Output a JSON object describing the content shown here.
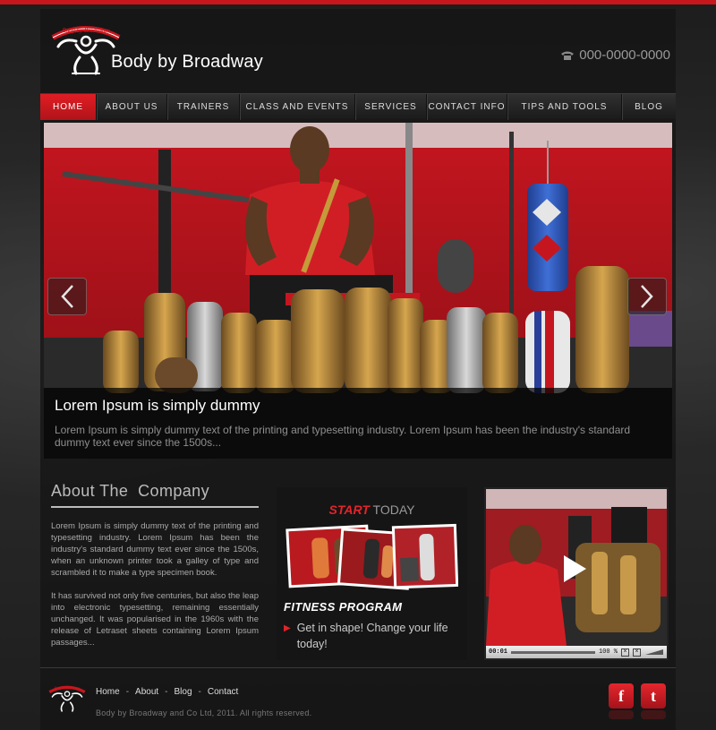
{
  "header": {
    "site_name": "Body by Broadway",
    "logo_text": "Body by Broadway",
    "phone": "000-0000-0000"
  },
  "nav": {
    "items": [
      {
        "label": "HOME",
        "active": true
      },
      {
        "label": "ABOUT US",
        "active": false
      },
      {
        "label": "TRAINERS",
        "active": false
      },
      {
        "label": "CLASS AND EVENTS",
        "active": false
      },
      {
        "label": "SERVICES",
        "active": false
      },
      {
        "label": "CONTACT INFO",
        "active": false
      },
      {
        "label": "TIPS AND TOOLS",
        "active": false
      },
      {
        "label": "BLOG",
        "active": false
      }
    ]
  },
  "slider": {
    "caption_title": "Lorem Ipsum is simply dummy",
    "caption_text": "Lorem Ipsum is simply dummy text of the printing and typesetting industry. Lorem Ipsum has been the industry's standard dummy text ever since the 1500s..."
  },
  "about": {
    "heading": "About The  Company",
    "paragraph_1": "Lorem Ipsum is simply dummy text of the printing and typesetting industry. Lorem Ipsum has been the industry's standard dummy text ever since the 1500s, when an unknown printer took a galley of type and scrambled it to make a type specimen book.",
    "paragraph_2": "It has survived not only five centuries, but also the leap into electronic typesetting, remaining essentially unchanged. It was popularised in the 1960s with the release of Letraset sheets containing Lorem Ipsum passages..."
  },
  "start_today": {
    "title_red": "START",
    "title_rest": " TODAY",
    "program_title": "FITNESS PROGRAM",
    "program_text": "Get in shape! Change your life today!"
  },
  "video": {
    "time": "00:01",
    "volume": "100 %"
  },
  "footer": {
    "links": [
      "Home",
      "About",
      "Blog",
      "Contact"
    ],
    "separator": "-",
    "copyright": "Body by Broadway and Co Ltd, 2011. All rights reserved."
  },
  "social": {
    "facebook": "f",
    "twitter": "t"
  },
  "colors": {
    "accent": "#c8161d",
    "background": "#2b2b2b"
  }
}
